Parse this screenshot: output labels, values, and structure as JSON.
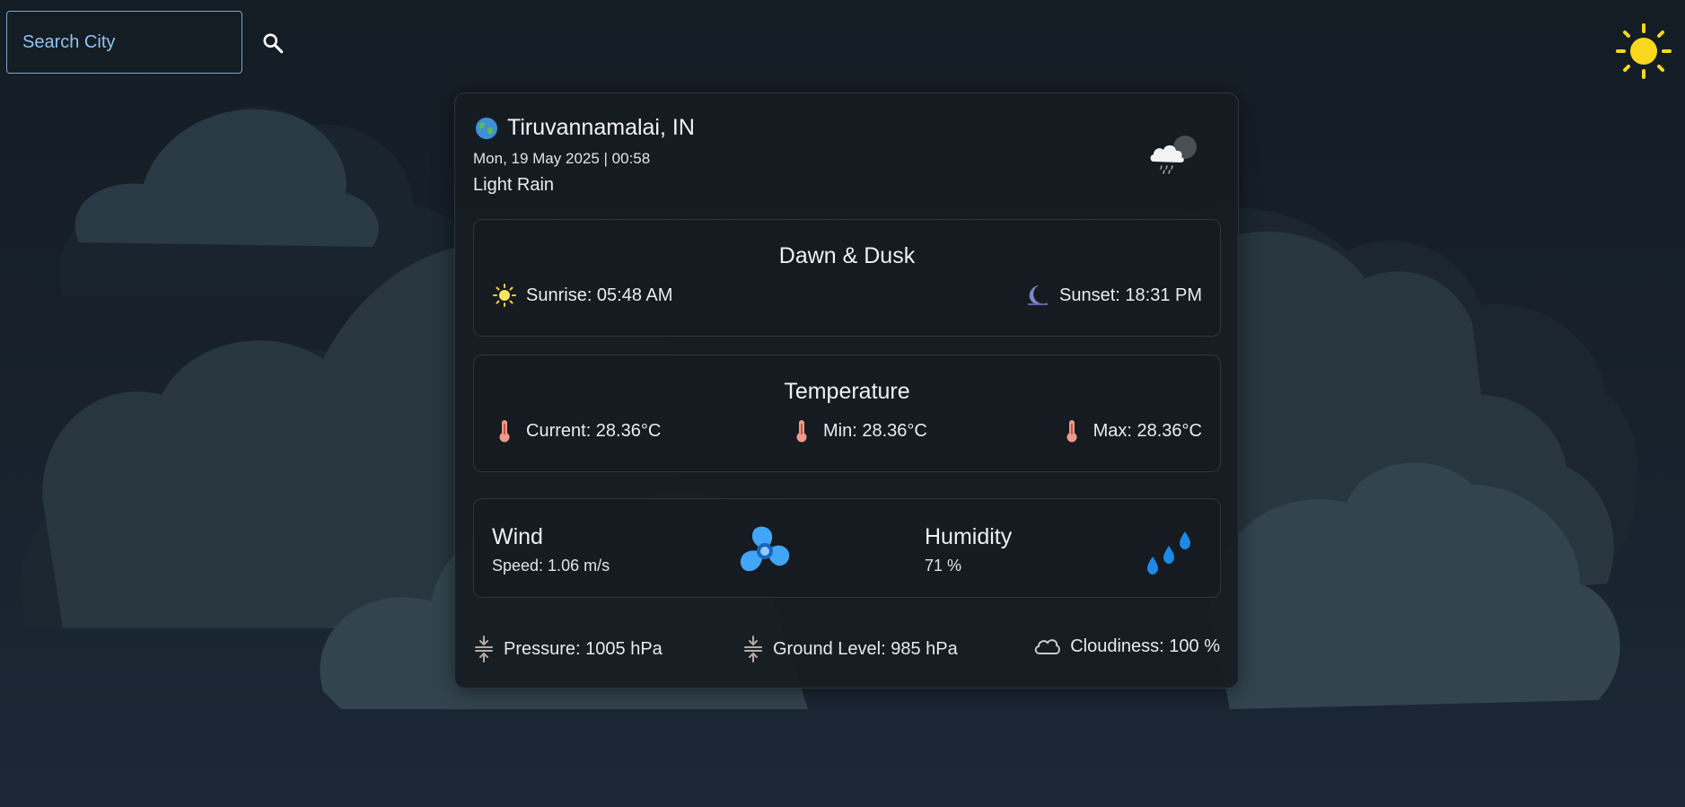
{
  "search": {
    "placeholder": "Search City",
    "value": ""
  },
  "icons": {
    "search": "search-icon",
    "theme": "sun-icon",
    "globe": "globe-icon",
    "weather": "cloud-rain-night-icon",
    "sunrise": "sun-icon",
    "sunset": "moon-icon",
    "thermometer": "thermometer-icon",
    "wind": "fan-icon",
    "humidity": "droplets-icon",
    "pressure": "compress-icon",
    "cloudiness": "cloud-outline-icon"
  },
  "colors": {
    "accent_sun": "#f9d71c",
    "fan_blue": "#42a5f5",
    "drop_blue": "#1e88e5",
    "thermo": "#ef9a8a",
    "moon": "#7e87c9"
  },
  "location": {
    "name": "Tiruvannamalai, IN",
    "datetime": "Mon, 19 May 2025 | 00:58",
    "condition": "Light Rain"
  },
  "dawn_dusk": {
    "title": "Dawn & Dusk",
    "sunrise": "Sunrise: 05:48 AM",
    "sunset": "Sunset: 18:31 PM"
  },
  "temperature": {
    "title": "Temperature",
    "current": "Current: 28.36°C",
    "min": "Min: 28.36°C",
    "max": "Max: 28.36°C"
  },
  "wind": {
    "label": "Wind",
    "speed": "Speed: 1.06 m/s"
  },
  "humidity": {
    "label": "Humidity",
    "value": "71 %"
  },
  "footer": {
    "pressure": "Pressure: 1005 hPa",
    "ground_level": "Ground Level: 985 hPa",
    "cloudiness": "Cloudiness: 100 %"
  }
}
